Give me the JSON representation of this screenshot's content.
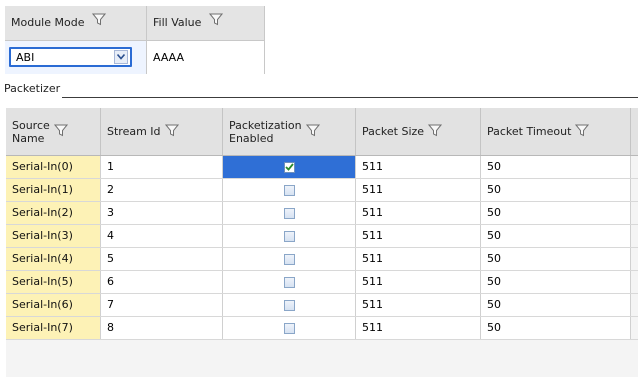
{
  "module_grid": {
    "columns": [
      "Module Mode",
      "Fill Value"
    ],
    "row": {
      "module_mode": "ABI",
      "fill_value": "AAAA"
    }
  },
  "section": {
    "title": "Packetizer"
  },
  "packetizer": {
    "columns": {
      "source_name_line1": "Source",
      "source_name_line2": "Name",
      "stream_id": "Stream Id",
      "pkt_enabled_line1": "Packetization",
      "pkt_enabled_line2": "Enabled",
      "packet_size": "Packet Size",
      "packet_timeout": "Packet Timeout"
    },
    "rows": [
      {
        "source": "Serial-In(0)",
        "stream_id": "1",
        "enabled": true,
        "size": "511",
        "timeout": "50"
      },
      {
        "source": "Serial-In(1)",
        "stream_id": "2",
        "enabled": false,
        "size": "511",
        "timeout": "50"
      },
      {
        "source": "Serial-In(2)",
        "stream_id": "3",
        "enabled": false,
        "size": "511",
        "timeout": "50"
      },
      {
        "source": "Serial-In(3)",
        "stream_id": "4",
        "enabled": false,
        "size": "511",
        "timeout": "50"
      },
      {
        "source": "Serial-In(4)",
        "stream_id": "5",
        "enabled": false,
        "size": "511",
        "timeout": "50"
      },
      {
        "source": "Serial-In(5)",
        "stream_id": "6",
        "enabled": false,
        "size": "511",
        "timeout": "50"
      },
      {
        "source": "Serial-In(6)",
        "stream_id": "7",
        "enabled": false,
        "size": "511",
        "timeout": "50"
      },
      {
        "source": "Serial-In(7)",
        "stream_id": "8",
        "enabled": false,
        "size": "511",
        "timeout": "50"
      }
    ]
  }
}
